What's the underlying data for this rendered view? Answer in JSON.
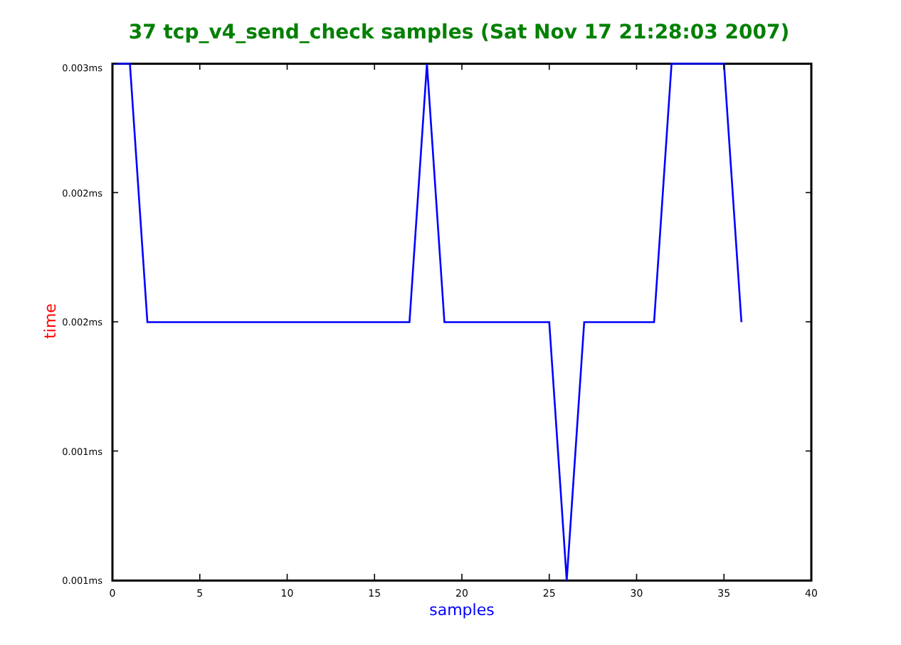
{
  "chart_data": {
    "type": "line",
    "title": "37 tcp_v4_send_check samples (Sat Nov 17 21:28:03 2007)",
    "xlabel": "samples",
    "ylabel": "time",
    "x": [
      0,
      1,
      2,
      3,
      4,
      5,
      6,
      7,
      8,
      9,
      10,
      11,
      12,
      13,
      14,
      15,
      16,
      17,
      18,
      19,
      20,
      21,
      22,
      23,
      24,
      25,
      26,
      27,
      28,
      29,
      30,
      31,
      32,
      33,
      34,
      35,
      36
    ],
    "series": [
      {
        "color": "#0000ff",
        "values": [
          0.003,
          0.003,
          0.002,
          0.002,
          0.002,
          0.002,
          0.002,
          0.002,
          0.002,
          0.002,
          0.002,
          0.002,
          0.002,
          0.002,
          0.002,
          0.002,
          0.002,
          0.002,
          0.003,
          0.002,
          0.002,
          0.002,
          0.002,
          0.002,
          0.002,
          0.002,
          0.001,
          0.002,
          0.002,
          0.002,
          0.002,
          0.002,
          0.003,
          0.003,
          0.003,
          0.003,
          0.002
        ]
      }
    ],
    "xlim": [
      0,
      40
    ],
    "ylim": [
      0.001,
      0.003
    ],
    "xticks": [
      0,
      5,
      10,
      15,
      20,
      25,
      30,
      35,
      40
    ],
    "yticks": [
      {
        "value": 0.001,
        "label": "0.001ms"
      },
      {
        "value": 0.0015,
        "label": "0.001ms"
      },
      {
        "value": 0.002,
        "label": "0.002ms"
      },
      {
        "value": 0.0025,
        "label": "0.002ms"
      },
      {
        "value": 0.003,
        "label": "0.003ms"
      }
    ]
  }
}
